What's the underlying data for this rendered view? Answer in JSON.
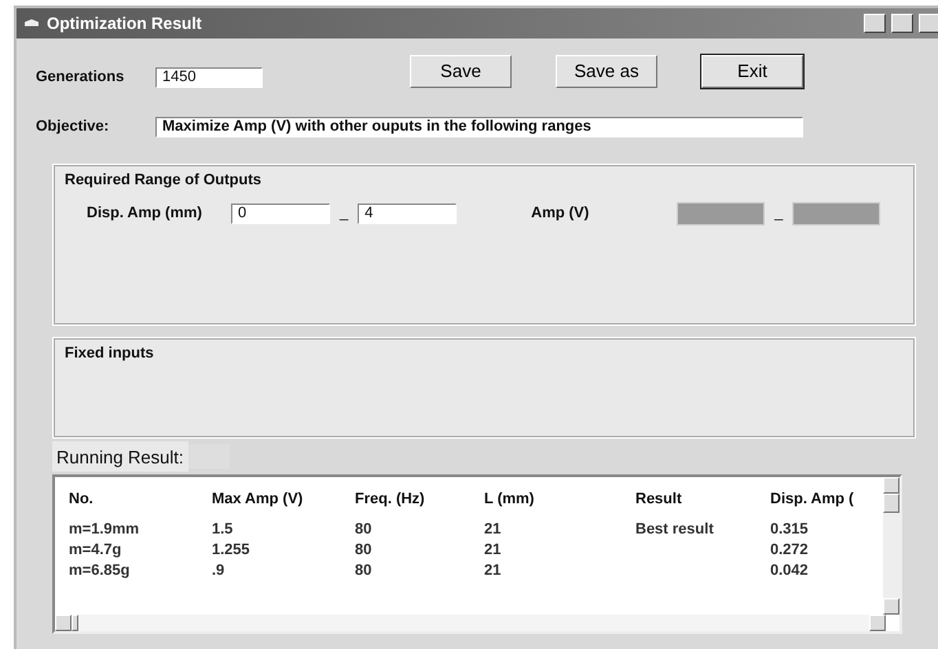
{
  "window": {
    "title": "Optimization Result"
  },
  "generations": {
    "label": "Generations",
    "value": "1450"
  },
  "buttons": [
    {
      "label": "Save"
    },
    {
      "label": "Save as"
    },
    {
      "label": "Exit"
    }
  ],
  "objective": {
    "label": "Objective:",
    "value": "Maximize Amp (V) with other ouputs in the following ranges"
  },
  "required_range": {
    "title": "Required Range of Outputs",
    "outputs": [
      {
        "label": "Disp. Amp (mm)",
        "from": {
          "value": "0",
          "disabled": false
        },
        "separator": "_",
        "to": {
          "value": "4",
          "disabled": false
        }
      },
      {
        "label": "Amp (V)",
        "from": {
          "disabled": true
        },
        "separator": "_",
        "to": {
          "disabled": true
        }
      }
    ]
  },
  "fixed_inputs": {
    "title": "Fixed inputs"
  },
  "running_result": {
    "label": "Running Result:",
    "table": {
      "columns": [
        "No.",
        "Max Amp (V)",
        "Freq. (Hz)",
        "L (mm)",
        "Result",
        "Disp. Amp ("
      ],
      "rows": [
        [
          "m=1.9mm",
          "1.5",
          "80",
          "21",
          "Best result",
          "0.315"
        ],
        [
          "m=4.7g",
          "1.255",
          "80",
          "21",
          null,
          "0.272"
        ],
        [
          "m=6.85g",
          ".9",
          "80",
          "21",
          null,
          "0.042"
        ]
      ]
    }
  }
}
